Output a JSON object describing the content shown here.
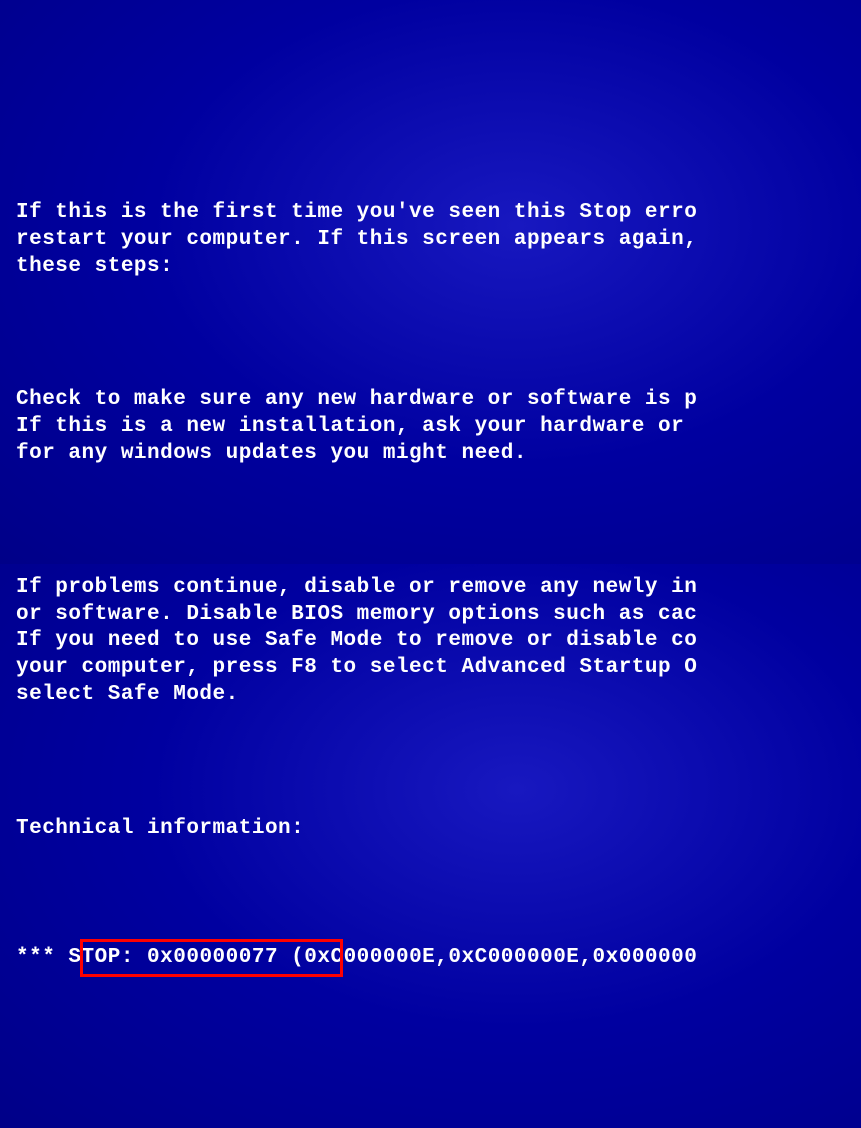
{
  "bsod": {
    "para1": "If this is the first time you've seen this Stop erro\nrestart your computer. If this screen appears again,\nthese steps:",
    "para2": "Check to make sure any new hardware or software is p\nIf this is a new installation, ask your hardware or\nfor any windows updates you might need.",
    "para3": "If problems continue, disable or remove any newly in\nor software. Disable BIOS memory options such as cac\nIf you need to use Safe Mode to remove or disable co\nyour computer, press F8 to select Advanced Startup O\nselect Safe Mode.",
    "tech_header": "Technical information:",
    "stop_prefix": "*** ",
    "stop_code": "STOP: 0x00000077",
    "stop_params": " (0xC000000E,0xC000000E,0x000000"
  }
}
